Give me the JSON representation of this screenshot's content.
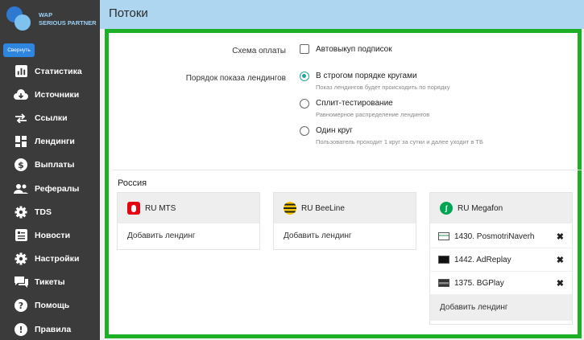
{
  "brand": {
    "line1": "WAP",
    "line2": "SERIOUS PARTNER"
  },
  "sidebar": {
    "collapse_label": "Свернуть",
    "items": [
      {
        "label": "Статистика",
        "icon": "chart-icon"
      },
      {
        "label": "Источники",
        "icon": "cloud-download-icon"
      },
      {
        "label": "Ссылки",
        "icon": "swap-arrows-icon"
      },
      {
        "label": "Лендинги",
        "icon": "dashboard-icon"
      },
      {
        "label": "Выплаты",
        "icon": "dollar-icon"
      },
      {
        "label": "Рефералы",
        "icon": "people-icon"
      },
      {
        "label": "TDS",
        "icon": "gear-icon"
      },
      {
        "label": "Новости",
        "icon": "news-icon"
      },
      {
        "label": "Настройки",
        "icon": "gear-icon"
      },
      {
        "label": "Тикеты",
        "icon": "forum-icon"
      },
      {
        "label": "Помощь",
        "icon": "help-icon"
      },
      {
        "label": "Правила",
        "icon": "info-icon"
      }
    ]
  },
  "header": {
    "title": "Потоки"
  },
  "form": {
    "payment_label": "Схема оплаты",
    "payment_option": "Автовыкуп подписок",
    "payment_checked": false,
    "order_label": "Порядок показа лендингов",
    "order_options": [
      {
        "title": "В строгом порядке кругами",
        "hint": "Показ лендингов будет происходить по порядку",
        "checked": true
      },
      {
        "title": "Сплит-тестирование",
        "hint": "Равномерное распределение лендингов",
        "checked": false
      },
      {
        "title": "Один круг",
        "hint": "Пользователь проходит 1 круг за сутки и далее уходит в ТБ",
        "checked": false
      }
    ]
  },
  "region": {
    "title": "Россия",
    "operators": [
      {
        "name": "RU MTS",
        "icon": "mts-icon",
        "color": "#e30611",
        "add_label": "Добавить лендинг",
        "landings": []
      },
      {
        "name": "RU BeeLine",
        "icon": "beeline-icon",
        "color": "#f7c600",
        "add_label": "Добавить лендинг",
        "landings": []
      },
      {
        "name": "RU Megafon",
        "icon": "megafon-icon",
        "color": "#00a651",
        "add_label": "Добавить лендинг",
        "landings": [
          "1430. PosmotriNaverh",
          "1442. AdReplay",
          "1375. BGPlay"
        ]
      }
    ]
  }
}
